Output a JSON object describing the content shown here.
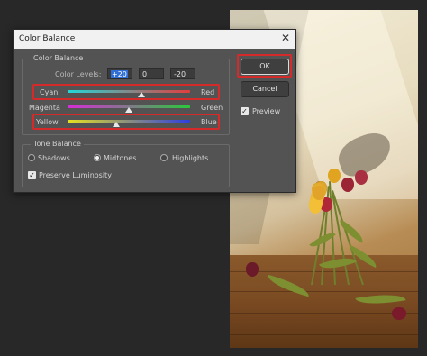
{
  "dialog": {
    "title": "Color Balance",
    "close_glyph": "✕",
    "color_balance_group": {
      "legend": "Color Balance",
      "levels_label": "Color Levels:",
      "levels": [
        "+20",
        "0",
        "-20"
      ],
      "sliders": [
        {
          "left": "Cyan",
          "right": "Red",
          "value": 20
        },
        {
          "left": "Magenta",
          "right": "Green",
          "value": 0
        },
        {
          "left": "Yellow",
          "right": "Blue",
          "value": -20
        }
      ]
    },
    "tone_balance_group": {
      "legend": "Tone Balance",
      "options": [
        "Shadows",
        "Midtones",
        "Highlights"
      ],
      "selected": "Midtones",
      "preserve_luminosity": {
        "label": "Preserve Luminosity",
        "checked": true
      }
    },
    "buttons": {
      "ok": "OK",
      "cancel": "Cancel"
    },
    "preview": {
      "label": "Preview",
      "checked": true
    },
    "check_glyph": "✓"
  },
  "colors": {
    "highlight": "#d42a2a",
    "selection": "#2f6fd6"
  }
}
